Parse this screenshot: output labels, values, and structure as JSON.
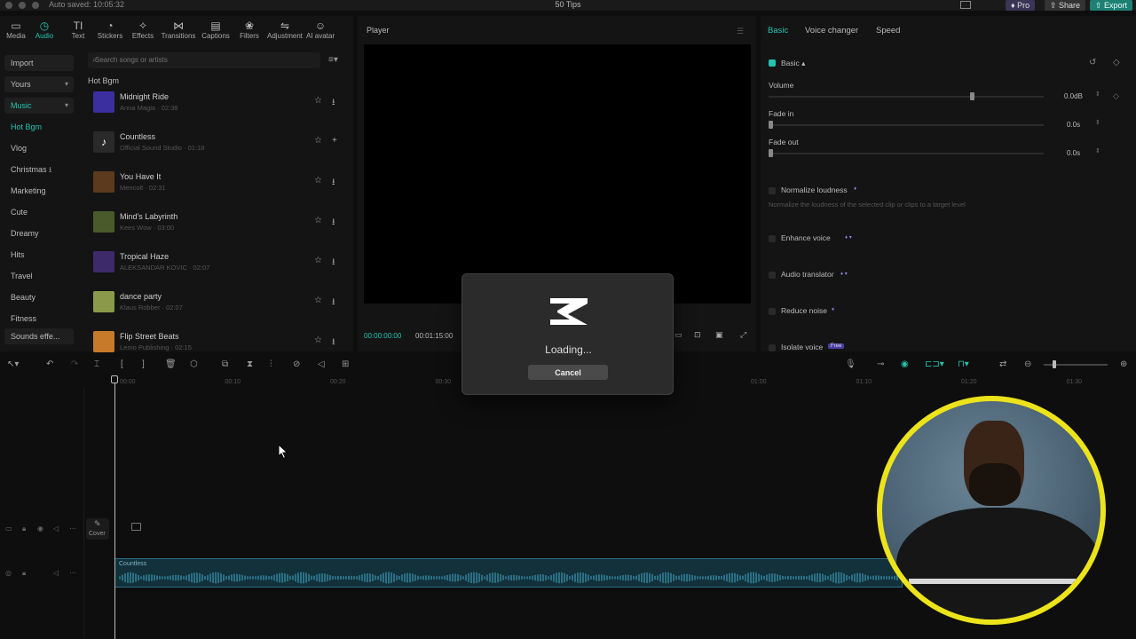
{
  "window": {
    "autosave": "Auto saved: 10:05:32",
    "title": "50 Tips"
  },
  "topbar": {
    "pro": "Pro",
    "share": "Share",
    "export": "Export"
  },
  "tools": [
    {
      "label": "Media",
      "icon": "▭"
    },
    {
      "label": "Audio",
      "icon": "◷"
    },
    {
      "label": "Text",
      "icon": "TI"
    },
    {
      "label": "Stickers",
      "icon": "◔"
    },
    {
      "label": "Effects",
      "icon": "✧"
    },
    {
      "label": "Transitions",
      "icon": "⋈"
    },
    {
      "label": "Captions",
      "icon": "▤"
    },
    {
      "label": "Filters",
      "icon": "❀"
    },
    {
      "label": "Adjustment",
      "icon": "⇋"
    },
    {
      "label": "AI avatar",
      "icon": "☺"
    }
  ],
  "categories": [
    "Import",
    "Yours",
    "Music",
    "Hot Bgm",
    "Vlog",
    "Christmas",
    "Marketing",
    "Cute",
    "Dreamy",
    "Hits",
    "Travel",
    "Beauty",
    "Fitness",
    "Sounds effe..."
  ],
  "search": {
    "placeholder": "Search songs or artists"
  },
  "section_title": "Hot Bgm",
  "tracks": [
    {
      "title": "Midnight Ride",
      "meta": "Anna Magia · 02:38",
      "color": "#3b2fa0"
    },
    {
      "title": "Countless",
      "meta": "Official Sound Studio · 01:18",
      "color": "#2a2a2a"
    },
    {
      "title": "You Have It",
      "meta": "Mencolt · 02:31",
      "color": "#5b3a1e"
    },
    {
      "title": "Mind's Labyrinth",
      "meta": "Kees Wow · 03:00",
      "color": "#4a5a2a"
    },
    {
      "title": "Tropical Haze",
      "meta": "ALEKSANDAR KOVIC · 02:07",
      "color": "#3d2a6a"
    },
    {
      "title": "dance party",
      "meta": "Klaus Robber · 02:07",
      "color": "#8a9a4a"
    },
    {
      "title": "Flip Street Beats",
      "meta": "Lemo Publishing · 02:15",
      "color": "#c77a2a"
    }
  ],
  "player": {
    "label": "Player",
    "time_current": "00:00:00:00",
    "time_total": "00:01:15:00"
  },
  "right": {
    "tabs": [
      "Basic",
      "Voice changer",
      "Speed"
    ],
    "basic_header": "Basic",
    "volume_label": "Volume",
    "volume_value": "0.0dB",
    "volume_level": 0.74,
    "fadein_label": "Fade in",
    "fadein_value": "0.0s",
    "fadeout_label": "Fade out",
    "fadeout_value": "0.0s",
    "normalize_label": "Normalize loudness",
    "normalize_desc": "Normalize the loudness of the selected clip or clips to a target level",
    "enhance_label": "Enhance voice",
    "translator_label": "Audio translator",
    "reduce_label": "Reduce noise",
    "isolate_label": "Isolate voice",
    "isolate_badge": "Free"
  },
  "ruler": [
    "00:00",
    "00:10",
    "00:20",
    "00:30",
    "00:40",
    "00:50",
    "01:00",
    "01:10",
    "01:20",
    "01:30",
    "01:40"
  ],
  "timeline": {
    "cover_label": "Cover",
    "audio_clip": "Countless"
  },
  "dialog": {
    "loading": "Loading...",
    "cancel": "Cancel"
  },
  "colors": {
    "accent": "#22c4b0",
    "webcam_ring": "#ece31a"
  }
}
